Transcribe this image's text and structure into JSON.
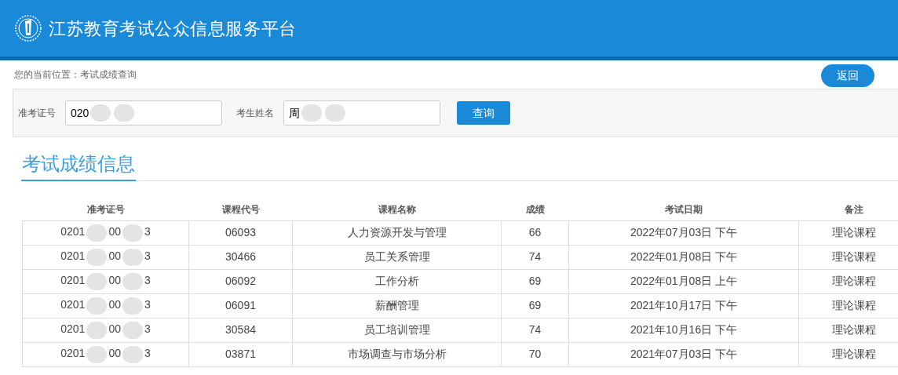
{
  "header": {
    "title": "江苏教育考试公众信息服务平台"
  },
  "breadcrumb": "您的当前位置：考试成绩查询",
  "back_button": "返回",
  "search": {
    "fields": [
      {
        "label": "准考证号",
        "value": "020"
      },
      {
        "label": "考生姓名",
        "value": "周"
      }
    ],
    "button": "查询"
  },
  "section_title": "考试成绩信息",
  "table": {
    "columns": [
      "准考证号",
      "课程代号",
      "课程名称",
      "成绩",
      "考试日期",
      "备注"
    ],
    "rows": [
      {
        "id_parts": [
          "0201",
          "00",
          "3"
        ],
        "code": "06093",
        "name": "人力资源开发与管理",
        "score": "66",
        "date": "2022年07月03日 下午",
        "note": "理论课程"
      },
      {
        "id_parts": [
          "0201",
          "00",
          "3"
        ],
        "code": "30466",
        "name": "员工关系管理",
        "score": "74",
        "date": "2022年01月08日 下午",
        "note": "理论课程"
      },
      {
        "id_parts": [
          "0201",
          "00",
          "3"
        ],
        "code": "06092",
        "name": "工作分析",
        "score": "69",
        "date": "2022年01月08日 上午",
        "note": "理论课程"
      },
      {
        "id_parts": [
          "0201",
          "00",
          "3"
        ],
        "code": "06091",
        "name": "薪酬管理",
        "score": "69",
        "date": "2021年10月17日 下午",
        "note": "理论课程"
      },
      {
        "id_parts": [
          "0201",
          "00",
          "3"
        ],
        "code": "30584",
        "name": "员工培训管理",
        "score": "74",
        "date": "2021年10月16日 下午",
        "note": "理论课程"
      },
      {
        "id_parts": [
          "0201",
          "00",
          "3"
        ],
        "code": "03871",
        "name": "市场调查与市场分析",
        "score": "70",
        "date": "2021年07月03日 下午",
        "note": "理论课程"
      }
    ]
  }
}
